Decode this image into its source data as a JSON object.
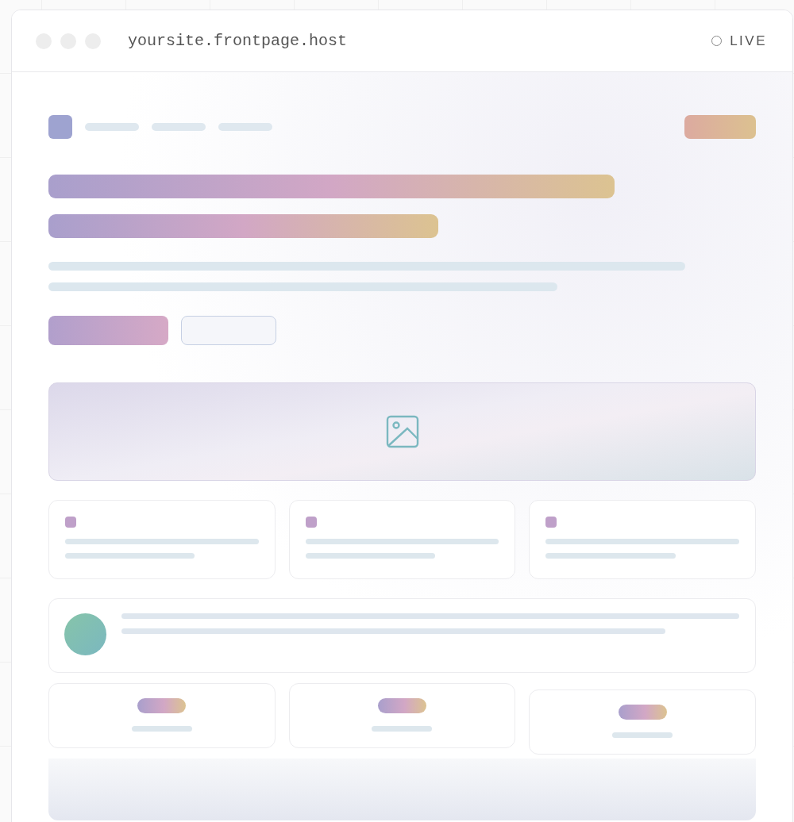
{
  "window": {
    "address": "yoursite.frontpage.host",
    "status": "LIVE"
  }
}
